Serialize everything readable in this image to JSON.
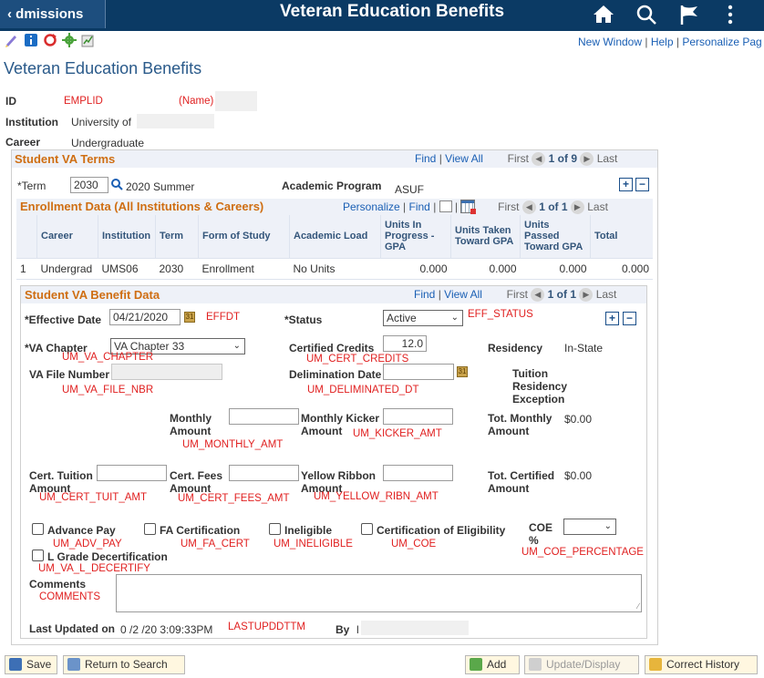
{
  "topbar": {
    "back_label": "dmissions",
    "title": "Veteran Education Benefits"
  },
  "toolbar": {
    "new_window": "New Window",
    "help": "Help",
    "personalize_page": "Personalize Pag"
  },
  "page_title": "Veteran Education Benefits",
  "header": {
    "id_label": "ID",
    "id_value": "EMPLID",
    "name_value": "(Name)",
    "institution_label": "Institution",
    "institution_value": "University of",
    "career_label": "Career",
    "career_value": "Undergraduate"
  },
  "va_terms": {
    "title": "Student VA Terms",
    "find": "Find",
    "view_all": "View All",
    "first": "First",
    "count": "1 of 9",
    "last": "Last",
    "term_label": "*Term",
    "term_value": "2030",
    "term_desc": "2020 Summer",
    "acad_prog_label": "Academic Program",
    "acad_prog_value": "ASUF"
  },
  "enrollment": {
    "title": "Enrollment Data (All Institutions & Careers)",
    "personalize": "Personalize",
    "find": "Find",
    "first": "First",
    "count": "1 of 1",
    "last": "Last",
    "columns": [
      "Career",
      "Institution",
      "Term",
      "Form of Study",
      "Academic Load",
      "Units In Progress - GPA",
      "Units Taken Toward GPA",
      "Units Passed Toward GPA",
      "Total"
    ],
    "row": {
      "num": "1",
      "career": "Undergrad",
      "institution": "UMS06",
      "term": "2030",
      "form": "Enrollment",
      "load": "No Units",
      "in_progress": "0.000",
      "taken": "0.000",
      "passed": "0.000",
      "total": "0.000"
    }
  },
  "benefit": {
    "title": "Student VA Benefit Data",
    "find": "Find",
    "view_all": "View All",
    "first": "First",
    "count": "1 of 1",
    "last": "Last",
    "eff_date_label": "*Effective Date",
    "eff_date_value": "04/21/2020",
    "eff_date_field": "EFFDT",
    "status_label": "*Status",
    "status_value": "Active",
    "status_field": "EFF_STATUS",
    "chapter_label": "*VA Chapter",
    "chapter_value": "VA Chapter 33",
    "chapter_field": "UM_VA_CHAPTER",
    "cert_credits_label": "Certified Credits",
    "cert_credits_value": "12.0",
    "cert_credits_field": "UM_CERT_CREDITS",
    "residency_label": "Residency",
    "residency_value": "In-State",
    "file_nbr_label": "VA File Number",
    "file_nbr_field": "UM_VA_FILE_NBR",
    "delim_label": "Delimination Date",
    "delim_field": "UM_DELIMINATED_DT",
    "tuition_res_label": "Tuition Residency Exception",
    "monthly_label": "Monthly Amount",
    "monthly_field": "UM_MONTHLY_AMT",
    "kicker_label": "Monthly Kicker Amount",
    "kicker_field": "UM_KICKER_AMT",
    "tot_monthly_label": "Tot. Monthly Amount",
    "tot_monthly_value": "$0.00",
    "cert_tuit_label": "Cert. Tuition Amount",
    "cert_tuit_field": "UM_CERT_TUIT_AMT",
    "cert_fees_label": "Cert. Fees Amount",
    "cert_fees_field": "UM_CERT_FEES_AMT",
    "yellow_label": "Yellow Ribbon Amount",
    "yellow_field": "UM_YELLOW_RIBN_AMT",
    "tot_cert_label": "Tot. Certified Amount",
    "tot_cert_value": "$0.00",
    "adv_pay_label": "Advance Pay",
    "adv_pay_field": "UM_ADV_PAY",
    "fa_cert_label": "FA Certification",
    "fa_cert_field": "UM_FA_CERT",
    "inelig_label": "Ineligible",
    "inelig_field": "UM_INELIGIBLE",
    "coe_cert_label": "Certification of Eligibility",
    "coe_cert_field": "UM_COE",
    "coe_pct_label": "COE %",
    "coe_pct_field": "UM_COE_PERCENTAGE",
    "lgrade_label": "L Grade Decertification",
    "lgrade_field": "UM_VA_L_DECERTIFY",
    "comments_label": "Comments",
    "comments_field": "COMMENTS",
    "last_updated_label": "Last Updated on",
    "last_updated_value": "0 /2 /20 3:09:33PM",
    "last_updated_field": "LASTUPDDTTM",
    "by_label": "By",
    "by_value": "l"
  },
  "footer": {
    "save": "Save",
    "return": "Return to Search",
    "add": "Add",
    "update": "Update/Display",
    "correct": "Correct History"
  },
  "colors": {
    "topbar": "#0b3a64",
    "section_header": "#cf6e12",
    "link": "#1a5fb4",
    "field_name": "#e02020"
  }
}
